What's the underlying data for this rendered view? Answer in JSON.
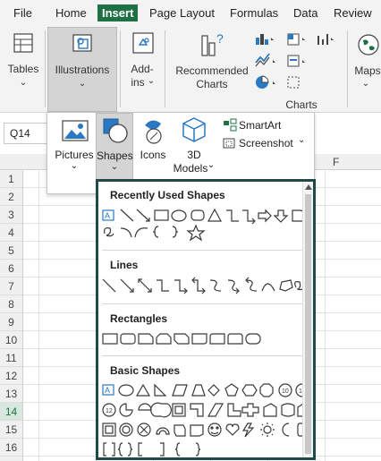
{
  "menu": {
    "tabs": [
      {
        "label": "File"
      },
      {
        "label": "Home"
      },
      {
        "label": "Insert"
      },
      {
        "label": "Page Layout"
      },
      {
        "label": "Formulas"
      },
      {
        "label": "Data"
      },
      {
        "label": "Review"
      }
    ]
  },
  "ribbon": {
    "tables": "Tables",
    "illustrations": "Illustrations",
    "addins_line1": "Add-",
    "addins_line2": "ins",
    "recommended_line1": "Recommended",
    "recommended_line2": "Charts",
    "charts_group": "Charts",
    "maps": "Maps"
  },
  "namebox": {
    "value": "Q14"
  },
  "grid": {
    "rows": [
      "1",
      "2",
      "3",
      "4",
      "5",
      "6",
      "7",
      "8",
      "9",
      "10",
      "11",
      "12",
      "13",
      "14",
      "15",
      "16"
    ],
    "selected_row": "14",
    "col_f": "F"
  },
  "illustrations_menu": {
    "pictures": "Pictures",
    "shapes": "Shapes",
    "icons": "Icons",
    "models_line1": "3D",
    "models_line2": "Models",
    "smartart": "SmartArt",
    "screenshot": "Screenshot"
  },
  "shapes_gallery": {
    "sections": [
      {
        "title": "Recently Used Shapes"
      },
      {
        "title": "Lines"
      },
      {
        "title": "Rectangles"
      },
      {
        "title": "Basic Shapes"
      }
    ],
    "octagon_number": "10",
    "dodecagon_number": "12"
  },
  "colors": {
    "accent": "#1e7145",
    "panel_border": "#1f4a46",
    "icon_blue": "#2b79c2"
  }
}
